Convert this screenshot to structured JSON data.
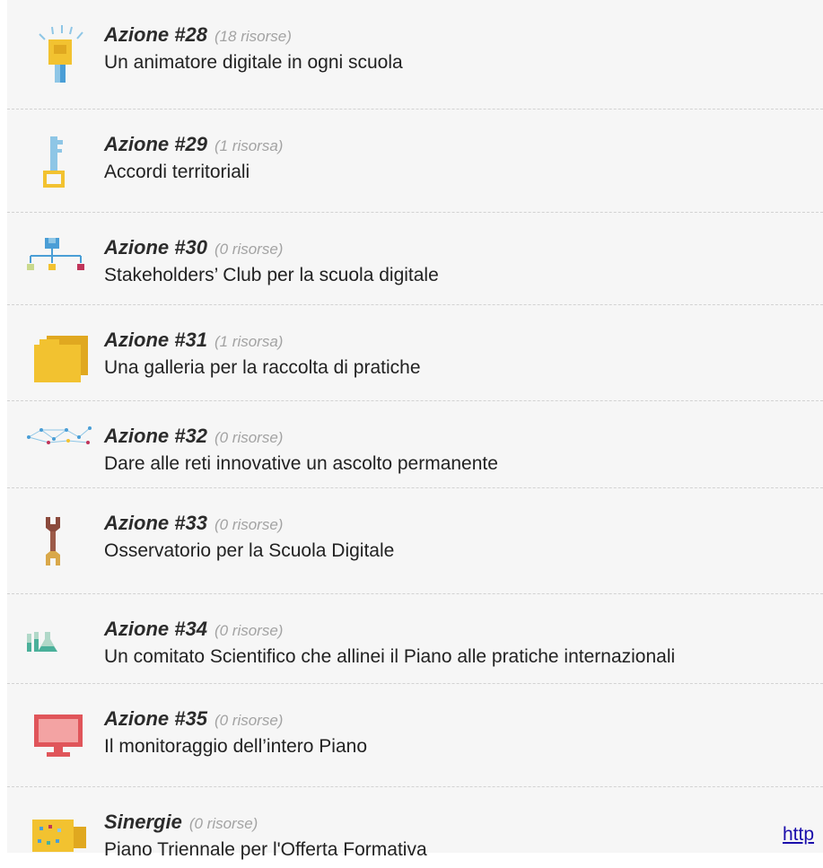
{
  "actions": [
    {
      "title": "Azione #28",
      "count": "(18 risorse)",
      "desc": "Un animatore digitale in ogni scuola",
      "icon": "lamp-icon"
    },
    {
      "title": "Azione #29",
      "count": "(1 risorsa)",
      "desc": "Accordi territoriali",
      "icon": "key-icon"
    },
    {
      "title": "Azione #30",
      "count": "(0 risorse)",
      "desc": "Stakeholders’ Club per la scuola digitale",
      "icon": "network-tree-icon"
    },
    {
      "title": "Azione #31",
      "count": "(1 risorsa)",
      "desc": "Una galleria per la raccolta di pratiche",
      "icon": "folder-icon"
    },
    {
      "title": "Azione #32",
      "count": "(0 risorse)",
      "desc": "Dare alle reti innovative un ascolto permanente",
      "icon": "network-dots-icon"
    },
    {
      "title": "Azione #33",
      "count": "(0 risorse)",
      "desc": "Osservatorio per la Scuola Digitale",
      "icon": "wrench-icon"
    },
    {
      "title": "Azione #34",
      "count": "(0 risorse)",
      "desc": "Un comitato Scientifico che allinei il Piano alle pratiche internazionali",
      "icon": "lab-flasks-icon"
    },
    {
      "title": "Azione #35",
      "count": "(0 risorse)",
      "desc": "Il monitoraggio dell’intero Piano",
      "icon": "monitor-icon"
    },
    {
      "title": "Sinergie",
      "count": "(0 risorse)",
      "desc": "Piano Triennale per l'Offerta Formativa",
      "icon": "board-icon"
    }
  ],
  "footer_link": "http"
}
